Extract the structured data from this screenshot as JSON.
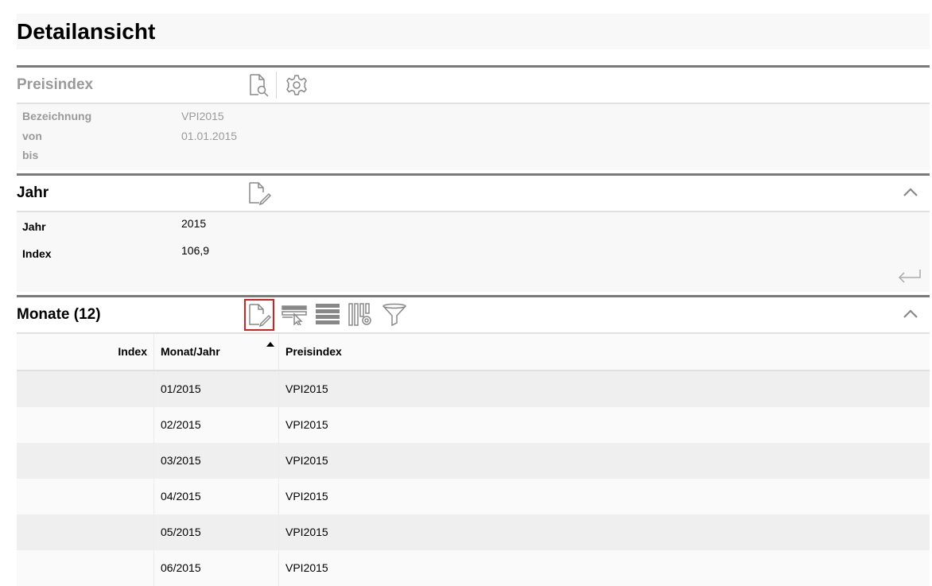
{
  "page": {
    "title": "Detailansicht"
  },
  "preisindex": {
    "title": "Preisindex",
    "fields": [
      {
        "label": "Bezeichnung",
        "value": "VPI2015"
      },
      {
        "label": "von",
        "value": "01.01.2015"
      },
      {
        "label": "bis",
        "value": ""
      }
    ],
    "icons": [
      "document-search-icon",
      "gear-icon"
    ]
  },
  "jahr": {
    "title": "Jahr",
    "fields": [
      {
        "label": "Jahr",
        "value": "2015"
      },
      {
        "label": "Index",
        "value": "106,9"
      }
    ],
    "icons": [
      "document-edit-icon",
      "chevron-up-icon",
      "return-icon"
    ]
  },
  "monate": {
    "title": "Monate (12)",
    "icons": [
      "document-edit-icon",
      "select-rows-icon",
      "list-rows-icon",
      "column-settings-icon",
      "filter-icon",
      "chevron-up-icon"
    ],
    "columns": [
      "Index",
      "Monat/Jahr",
      "Preisindex"
    ],
    "sorted_column": "Monat/Jahr",
    "rows": [
      {
        "index": "",
        "monat": "01/2015",
        "preis": "VPI2015"
      },
      {
        "index": "",
        "monat": "02/2015",
        "preis": "VPI2015"
      },
      {
        "index": "",
        "monat": "03/2015",
        "preis": "VPI2015"
      },
      {
        "index": "",
        "monat": "04/2015",
        "preis": "VPI2015"
      },
      {
        "index": "",
        "monat": "05/2015",
        "preis": "VPI2015"
      },
      {
        "index": "",
        "monat": "06/2015",
        "preis": "VPI2015"
      }
    ]
  },
  "colors": {
    "highlight": "#d32020",
    "icon": "#888888",
    "section_rule": "#7a7a7a"
  }
}
